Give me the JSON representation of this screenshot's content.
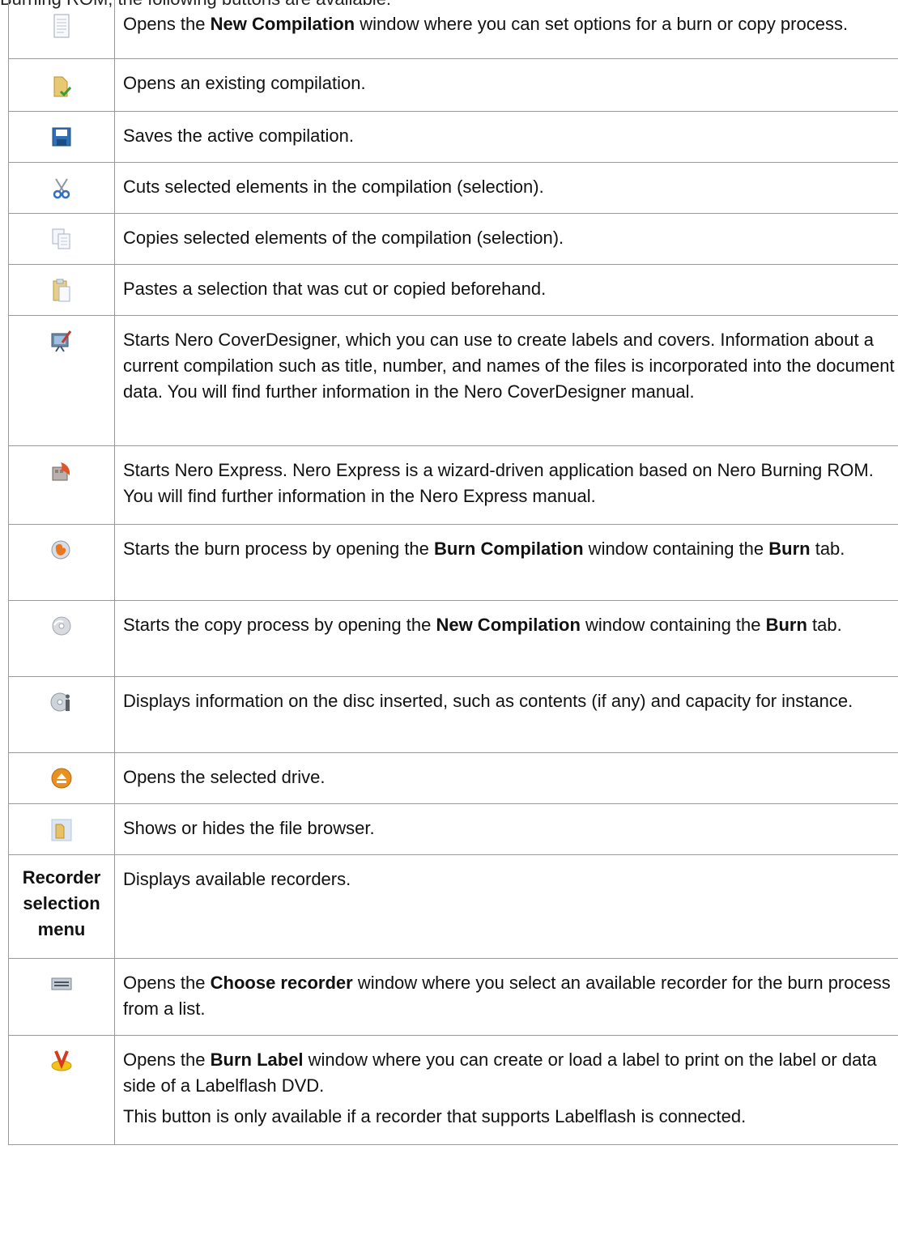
{
  "top_text": "Burning ROM, the following buttons are available:",
  "rows": [
    {
      "icon": "new-compilation-icon",
      "parts": [
        [
          "Opens the ",
          0
        ],
        [
          "New Compilation",
          1
        ],
        [
          " window where you can set options for a burn or copy process.",
          0
        ]
      ]
    },
    {
      "icon": "open-compilation-icon",
      "parts": [
        [
          "Opens an existing compilation.",
          0
        ]
      ]
    },
    {
      "icon": "save-icon",
      "parts": [
        [
          "Saves the active compilation.",
          0
        ]
      ]
    },
    {
      "icon": "cut-icon",
      "parts": [
        [
          "Cuts selected elements in the compilation (selection).",
          0
        ]
      ]
    },
    {
      "icon": "copy-icon",
      "parts": [
        [
          "Copies selected elements of the compilation (selection).",
          0
        ]
      ]
    },
    {
      "icon": "paste-icon",
      "parts": [
        [
          "Pastes a selection that was cut or copied beforehand.",
          0
        ]
      ]
    },
    {
      "icon": "cover-designer-icon",
      "parts": [
        [
          "Starts Nero CoverDesigner, which you can use to create labels and covers. Information about a current compilation such as title, number, and names of the files is incorporated into the document data. You will find further information in the Nero CoverDesigner manual.",
          0
        ]
      ]
    },
    {
      "icon": "nero-express-icon",
      "parts": [
        [
          "Starts Nero Express. Nero Express is a wizard-driven application based on Nero Burning ROM. You will find further information in the Nero Express manual.",
          0
        ]
      ]
    },
    {
      "icon": "burn-icon",
      "parts": [
        [
          "Starts the burn process by opening the ",
          0
        ],
        [
          "Burn Compilation",
          1
        ],
        [
          " window containing the ",
          0
        ],
        [
          "Burn",
          1
        ],
        [
          " tab.",
          0
        ]
      ]
    },
    {
      "icon": "copy-disc-icon",
      "parts": [
        [
          "Starts the copy process by opening the ",
          0
        ],
        [
          "New Compilation",
          1
        ],
        [
          " window containing the ",
          0
        ],
        [
          "Burn",
          1
        ],
        [
          " tab.",
          0
        ]
      ]
    },
    {
      "icon": "disc-info-icon",
      "parts": [
        [
          "Displays information on the disc inserted, such as contents (if any) and capacity for instance.",
          0
        ]
      ]
    },
    {
      "icon": "eject-icon",
      "parts": [
        [
          "Opens the selected drive.",
          0
        ]
      ]
    },
    {
      "icon": "file-browser-icon",
      "parts": [
        [
          "Shows or hides the file browser.",
          0
        ]
      ]
    },
    {
      "label": "Recorder selection menu",
      "parts": [
        [
          "Displays available recorders.",
          0
        ]
      ]
    },
    {
      "icon": "choose-recorder-icon",
      "parts": [
        [
          "Opens the ",
          0
        ],
        [
          "Choose recorder",
          1
        ],
        [
          " window where you select an available recorder for the burn process from a list.",
          0
        ]
      ]
    },
    {
      "icon": "burn-label-icon",
      "parts": [
        [
          "Opens the ",
          0
        ],
        [
          "Burn Label",
          1
        ],
        [
          " window where you can create or load a label to print on the label or data side of a Labelflash DVD.",
          0
        ]
      ],
      "extra": "This button is only available if a recorder that supports Labelflash is connected."
    }
  ]
}
